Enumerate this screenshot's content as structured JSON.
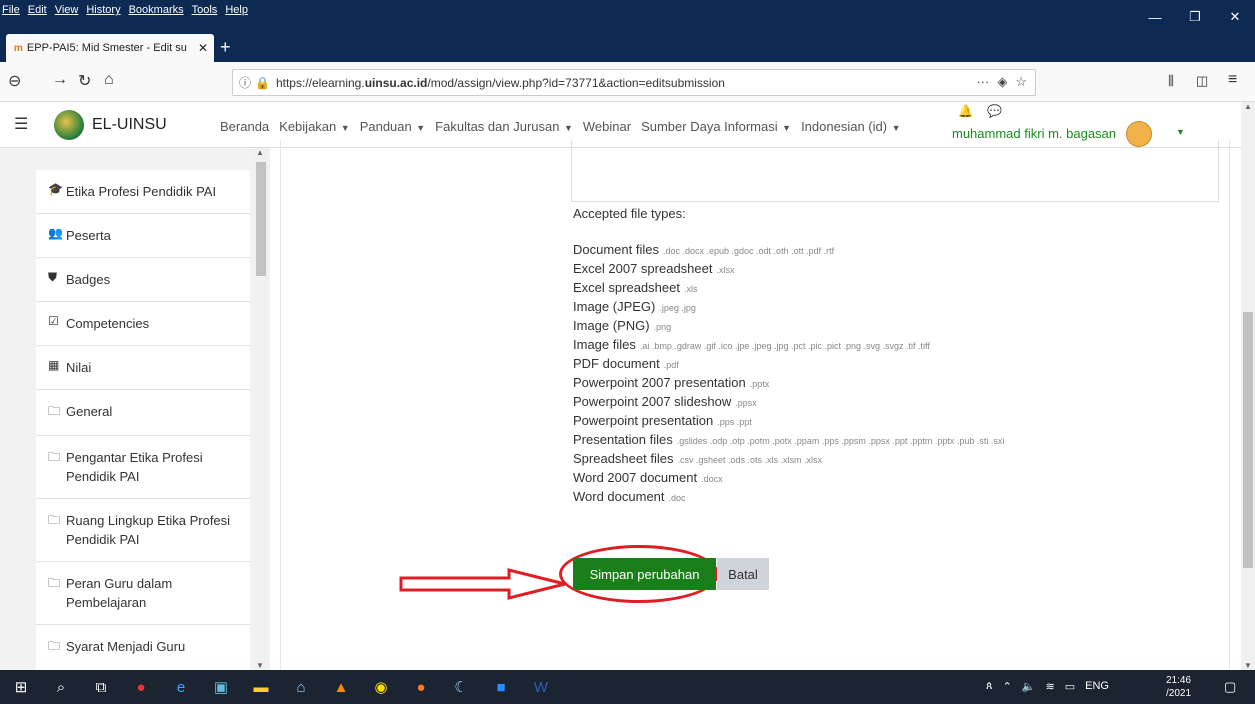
{
  "browser": {
    "menu": [
      "File",
      "Edit",
      "View",
      "History",
      "Bookmarks",
      "Tools",
      "Help"
    ],
    "tab_title": "EPP-PAI5: Mid Smester - Edit su",
    "url_prefix": "https://elearning.",
    "url_host": "uinsu.ac.id",
    "url_path": "/mod/assign/view.php?id=73771&action=editsubmission"
  },
  "header": {
    "brand": "EL-UINSU",
    "nav": [
      {
        "label": "Beranda",
        "caret": false
      },
      {
        "label": "Kebijakan",
        "caret": true
      },
      {
        "label": "Panduan",
        "caret": true
      },
      {
        "label": "Fakultas dan Jurusan",
        "caret": true
      },
      {
        "label": "Webinar",
        "caret": false
      },
      {
        "label": "Sumber Daya Informasi",
        "caret": true
      },
      {
        "label": "Indonesian (id)",
        "caret": true
      }
    ],
    "user_name": "muhammad fikri m. bagasan"
  },
  "sidebar": {
    "items": [
      {
        "icon": "graduation-cap-icon",
        "glyph": "🎓",
        "label": "Etika Profesi Pendidik PAI"
      },
      {
        "icon": "users-icon",
        "glyph": "👥",
        "label": "Peserta"
      },
      {
        "icon": "shield-icon",
        "glyph": "⛊",
        "label": "Badges"
      },
      {
        "icon": "checkbox-icon",
        "glyph": "☑",
        "label": "Competencies"
      },
      {
        "icon": "table-icon",
        "glyph": "▦",
        "label": "Nilai"
      },
      {
        "icon": "folder-icon",
        "glyph": "🗀",
        "label": "General"
      },
      {
        "icon": "folder-icon",
        "glyph": "🗀",
        "label": "Pengantar Etika Profesi Pendidik PAI"
      },
      {
        "icon": "folder-icon",
        "glyph": "🗀",
        "label": "Ruang Lingkup Etika Profesi Pendidik PAI"
      },
      {
        "icon": "folder-icon",
        "glyph": "🗀",
        "label": "Peran Guru dalam Pembelajaran"
      },
      {
        "icon": "folder-icon",
        "glyph": "🗀",
        "label": "Syarat Menjadi Guru"
      }
    ]
  },
  "main": {
    "accepted_label": "Accepted file types:",
    "file_types": [
      {
        "name": "Document files",
        "ext": ".doc .docx .epub .gdoc .odt .oth .ott .pdf .rtf"
      },
      {
        "name": "Excel 2007 spreadsheet",
        "ext": ".xlsx"
      },
      {
        "name": "Excel spreadsheet",
        "ext": ".xls"
      },
      {
        "name": "Image (JPEG)",
        "ext": ".jpeg .jpg"
      },
      {
        "name": "Image (PNG)",
        "ext": ".png"
      },
      {
        "name": "Image files",
        "ext": ".ai .bmp .gdraw .gif .ico .jpe .jpeg .jpg .pct .pic .pict .png .svg .svgz .tif .tiff"
      },
      {
        "name": "PDF document",
        "ext": ".pdf"
      },
      {
        "name": "Powerpoint 2007 presentation",
        "ext": ".pptx"
      },
      {
        "name": "Powerpoint 2007 slideshow",
        "ext": ".ppsx"
      },
      {
        "name": "Powerpoint presentation",
        "ext": ".pps .ppt"
      },
      {
        "name": "Presentation files",
        "ext": ".gslides .odp .otp .potm .potx .ppam .pps .ppsm .ppsx .ppt .pptm .pptx .pub .sti .sxi"
      },
      {
        "name": "Spreadsheet files",
        "ext": ".csv .gsheet .ods .ots .xls .xlsm .xlsx"
      },
      {
        "name": "Word 2007 document",
        "ext": ".docx"
      },
      {
        "name": "Word document",
        "ext": ".doc"
      }
    ],
    "save_label": "Simpan perubahan",
    "cancel_label": "Batal"
  },
  "taskbar": {
    "time": "21:46",
    "date": "/2021",
    "lang": "ENG"
  },
  "colors": {
    "accent_green": "#1a7f1a",
    "annotation_red": "#e01c24"
  }
}
